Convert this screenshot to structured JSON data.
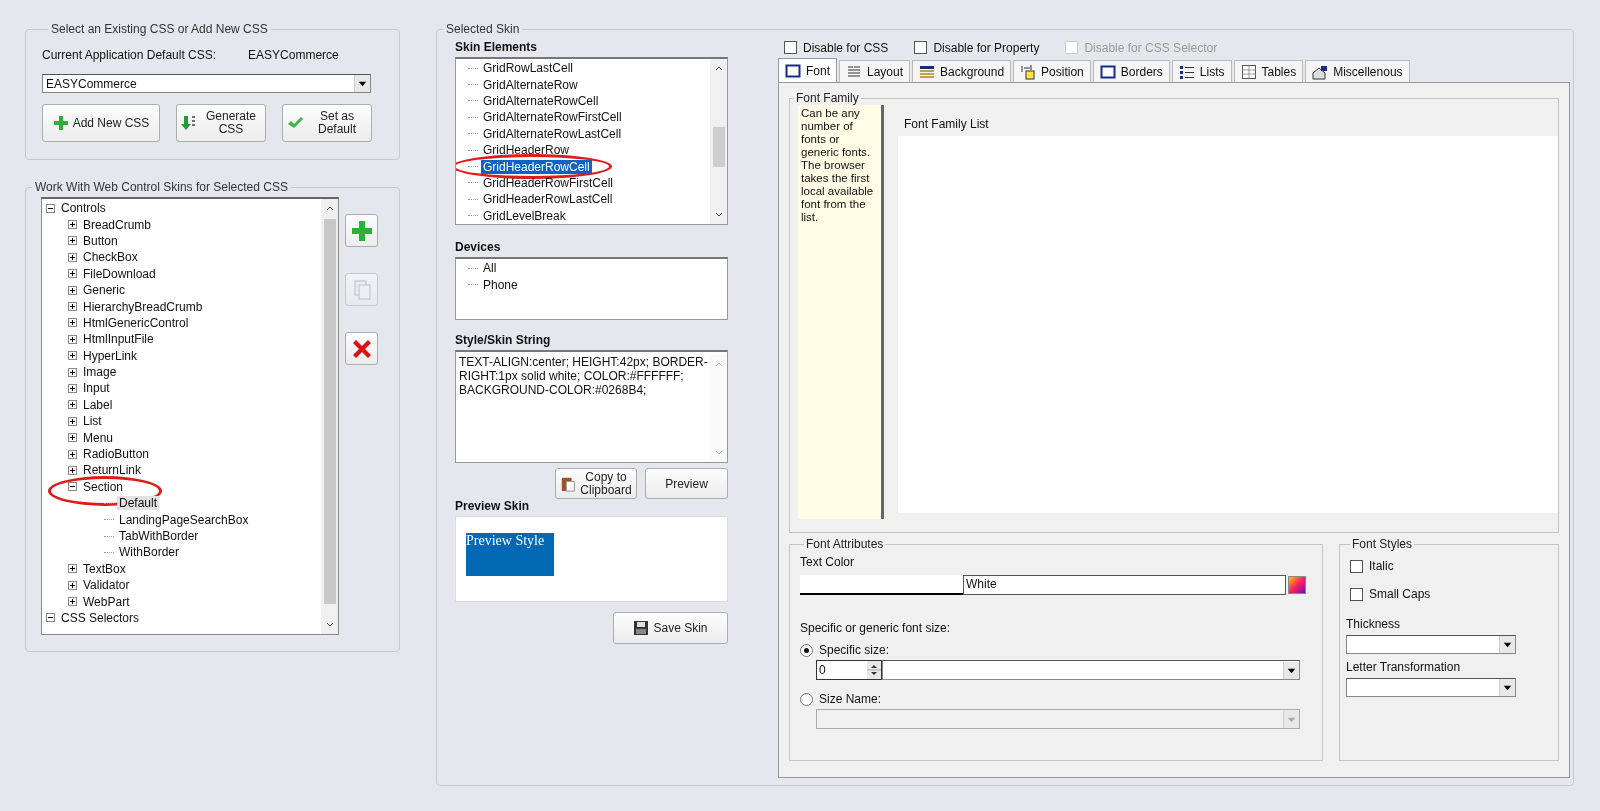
{
  "css_group": {
    "title": "Select an Existing CSS or Add New CSS",
    "default_label": "Current Application Default CSS:",
    "default_value": "EASYCommerce",
    "select_value": "EASYCommerce",
    "buttons": [
      {
        "kind": "add",
        "label": "Add New CSS"
      },
      {
        "kind": "generate",
        "label": "Generate CSS"
      },
      {
        "kind": "default",
        "label": "Set as Default"
      }
    ]
  },
  "skins_group": {
    "title": "Work With Web Control Skins for Selected CSS",
    "tree": [
      {
        "label": "Controls",
        "expanded": true,
        "selected": false,
        "circled": false,
        "children": [
          {
            "label": "BreadCrumb",
            "expanded": false,
            "selected": false,
            "circled": false
          },
          {
            "label": "Button",
            "expanded": false,
            "selected": false,
            "circled": false
          },
          {
            "label": "CheckBox",
            "expanded": false,
            "selected": false,
            "circled": false
          },
          {
            "label": "FileDownload",
            "expanded": false,
            "selected": false,
            "circled": false
          },
          {
            "label": "Generic",
            "expanded": false,
            "selected": false,
            "circled": false
          },
          {
            "label": "HierarchyBreadCrumb",
            "expanded": false,
            "selected": false,
            "circled": false
          },
          {
            "label": "HtmlGenericControl",
            "expanded": false,
            "selected": false,
            "circled": false
          },
          {
            "label": "HtmlInputFile",
            "expanded": false,
            "selected": false,
            "circled": false
          },
          {
            "label": "HyperLink",
            "expanded": false,
            "selected": false,
            "circled": false
          },
          {
            "label": "Image",
            "expanded": false,
            "selected": false,
            "circled": false
          },
          {
            "label": "Input",
            "expanded": false,
            "selected": false,
            "circled": false
          },
          {
            "label": "Label",
            "expanded": false,
            "selected": false,
            "circled": false
          },
          {
            "label": "List",
            "expanded": false,
            "selected": false,
            "circled": false
          },
          {
            "label": "Menu",
            "expanded": false,
            "selected": false,
            "circled": false
          },
          {
            "label": "RadioButton",
            "expanded": false,
            "selected": false,
            "circled": false
          },
          {
            "label": "ReturnLink",
            "expanded": false,
            "selected": false,
            "circled": false
          },
          {
            "label": "Section",
            "expanded": true,
            "selected": false,
            "circled": true,
            "children": [
              {
                "label": "Default",
                "selected": true,
                "circled": false
              },
              {
                "label": "LandingPageSearchBox",
                "selected": false,
                "circled": false
              },
              {
                "label": "TabWithBorder",
                "selected": false,
                "circled": false
              },
              {
                "label": "WithBorder",
                "selected": false,
                "circled": false
              }
            ]
          },
          {
            "label": "TextBox",
            "expanded": false,
            "selected": false,
            "circled": false
          },
          {
            "label": "Validator",
            "expanded": false,
            "selected": false,
            "circled": false
          },
          {
            "label": "WebPart",
            "expanded": false,
            "selected": false,
            "circled": false
          }
        ]
      },
      {
        "label": "CSS Selectors",
        "expanded": true,
        "selected": false,
        "circled": false
      }
    ],
    "side_buttons": [
      {
        "kind": "add",
        "disabled": false
      },
      {
        "kind": "copy",
        "disabled": true
      },
      {
        "kind": "delete",
        "disabled": false
      }
    ]
  },
  "selected_skin": {
    "title": "Selected Skin",
    "elements_label": "Skin Elements",
    "elements": [
      {
        "label": "GridRowLastCell",
        "selected": false,
        "circled": false
      },
      {
        "label": "GridAlternateRow",
        "selected": false,
        "circled": false
      },
      {
        "label": "GridAlternateRowCell",
        "selected": false,
        "circled": false
      },
      {
        "label": "GridAlternateRowFirstCell",
        "selected": false,
        "circled": false
      },
      {
        "label": "GridAlternateRowLastCell",
        "selected": false,
        "circled": false
      },
      {
        "label": "GridHeaderRow",
        "selected": false,
        "circled": false
      },
      {
        "label": "GridHeaderRowCell",
        "selected": true,
        "circled": true
      },
      {
        "label": "GridHeaderRowFirstCell",
        "selected": false,
        "circled": false
      },
      {
        "label": "GridHeaderRowLastCell",
        "selected": false,
        "circled": false
      },
      {
        "label": "GridLevelBreak",
        "selected": false,
        "circled": false
      }
    ],
    "devices_label": "Devices",
    "devices": [
      "All",
      "Phone"
    ],
    "style_label": "Style/Skin String",
    "style_string": "TEXT-ALIGN:center; HEIGHT:42px; BORDER-RIGHT:1px solid white; COLOR:#FFFFFF; BACKGROUND-COLOR:#0268B4;",
    "copy_button": "Copy to Clipboard",
    "preview_button": "Preview",
    "preview_label": "Preview Skin",
    "preview_text": "Preview Style",
    "save_button": "Save Skin",
    "options": [
      {
        "label": "Disable for CSS",
        "checked": false,
        "disabled": false
      },
      {
        "label": "Disable for Property",
        "checked": false,
        "disabled": false
      },
      {
        "label": "Disable for CSS Selector",
        "checked": false,
        "disabled": true
      }
    ],
    "tabs": [
      {
        "kind": "font",
        "label": "Font",
        "selected": true
      },
      {
        "kind": "layout",
        "label": "Layout",
        "selected": false
      },
      {
        "kind": "background",
        "label": "Background",
        "selected": false
      },
      {
        "kind": "position",
        "label": "Position",
        "selected": false
      },
      {
        "kind": "borders",
        "label": "Borders",
        "selected": false
      },
      {
        "kind": "lists",
        "label": "Lists",
        "selected": false
      },
      {
        "kind": "tables",
        "label": "Tables",
        "selected": false
      },
      {
        "kind": "misc",
        "label": "Miscellenous",
        "selected": false
      }
    ],
    "font_family": {
      "title": "Font Family",
      "hint": "Can be any number of fonts or generic fonts. The browser takes the first local available font from the list.",
      "list_header": "Font Family List"
    },
    "font_attributes": {
      "title": "Font Attributes",
      "text_color_label": "Text Color",
      "text_color_value": "White",
      "size_label": "Specific or generic font size:",
      "size_options": [
        {
          "label": "Specific size:",
          "selected": true
        },
        {
          "label": "Size Name:",
          "selected": false
        }
      ],
      "specific_size": "0"
    },
    "font_styles": {
      "title": "Font Styles",
      "checks": [
        {
          "label": "Italic",
          "checked": false
        },
        {
          "label": "Small Caps",
          "checked": false
        }
      ],
      "thickness_label": "Thickness",
      "transform_label": "Letter Transformation"
    }
  }
}
